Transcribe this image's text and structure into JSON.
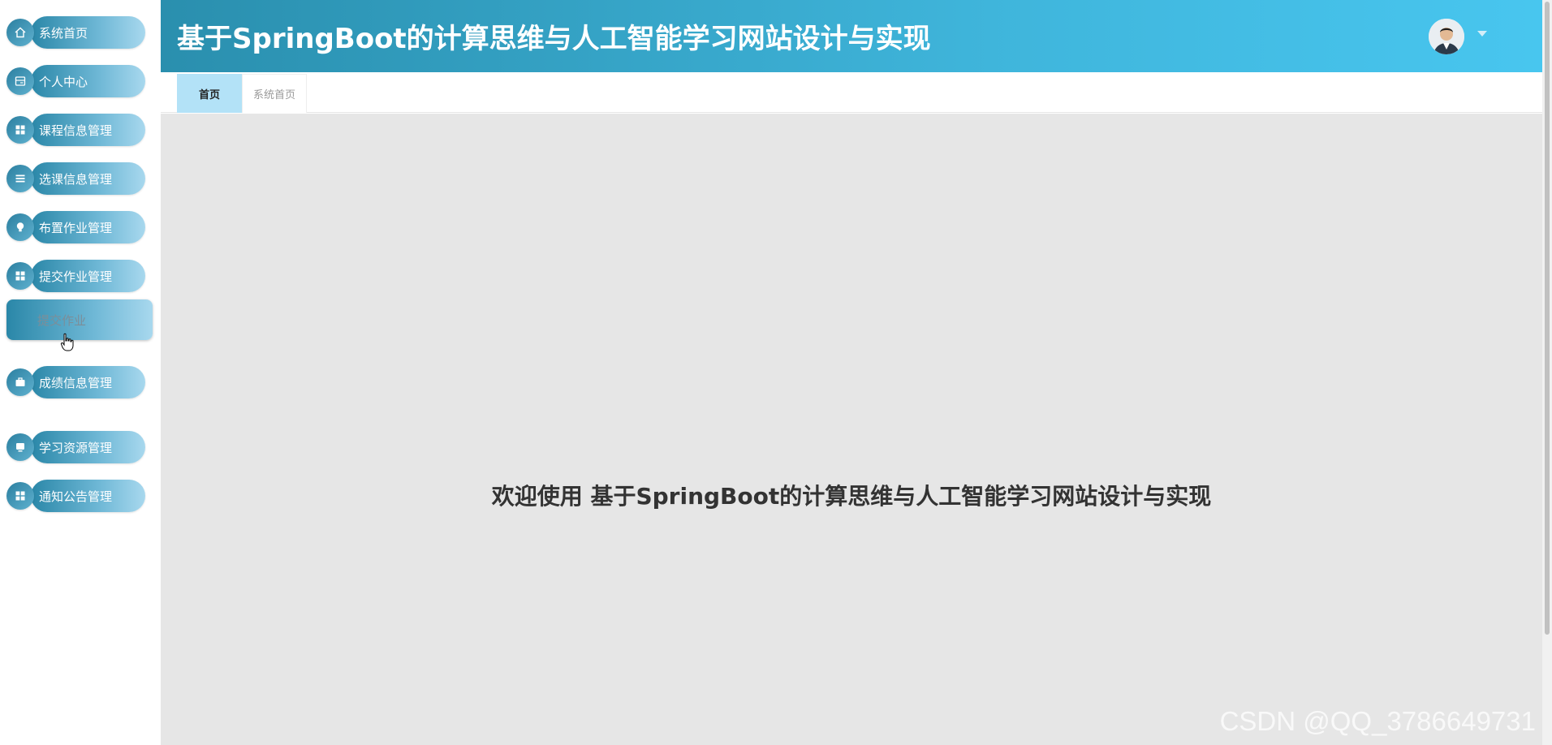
{
  "app": {
    "title": "基于SpringBoot的计算思维与人工智能学习网站设计与实现"
  },
  "sidebar": {
    "items": [
      {
        "label": "系统首页",
        "icon": "home-icon"
      },
      {
        "label": "个人中心",
        "icon": "id-card-icon"
      },
      {
        "label": "课程信息管理",
        "icon": "grid-icon"
      },
      {
        "label": "选课信息管理",
        "icon": "list-icon"
      },
      {
        "label": "布置作业管理",
        "icon": "bulb-icon"
      },
      {
        "label": "提交作业管理",
        "icon": "grid-icon"
      },
      {
        "label": "提交作业",
        "icon": "none",
        "active": true
      },
      {
        "label": "成绩信息管理",
        "icon": "briefcase-icon"
      },
      {
        "label": "学习资源管理",
        "icon": "monitor-icon"
      },
      {
        "label": "通知公告管理",
        "icon": "grid-icon"
      }
    ]
  },
  "tabs": [
    {
      "label": "首页",
      "active": true
    },
    {
      "label": "系统首页",
      "active": false
    }
  ],
  "main": {
    "welcome": "欢迎使用 基于SpringBoot的计算思维与人工智能学习网站设计与实现"
  },
  "watermark": "CSDN @QQ_3786649731",
  "colors": {
    "header_start": "#2a8fae",
    "header_end": "#48c6ef",
    "active_tab": "#b3e2f7",
    "main_bg": "#e6e6e6"
  }
}
